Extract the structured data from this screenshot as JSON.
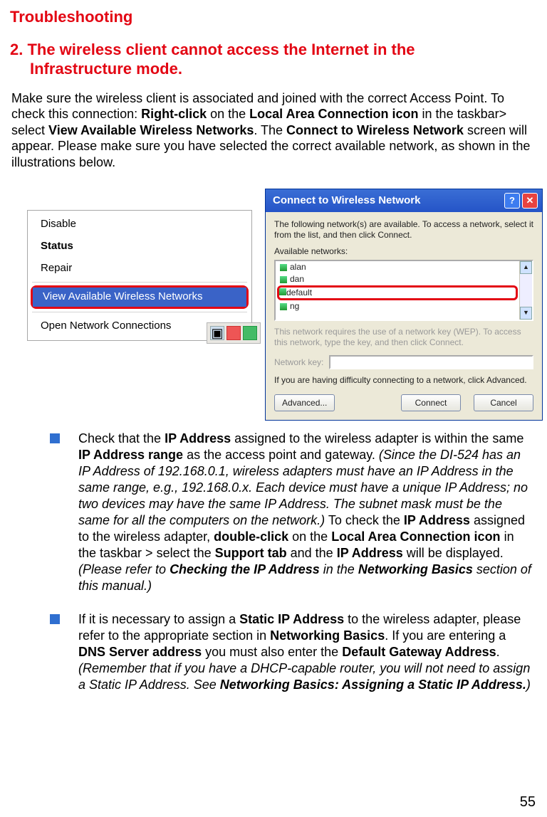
{
  "page_number": "55",
  "h1": "Troubleshooting",
  "h2_line1": "2. The wireless client cannot access the Internet in the",
  "h2_line2": "Infrastructure mode.",
  "intro": {
    "p1a": "Make sure the wireless client is associated and joined with the correct Access Point. To check this connection: ",
    "b1": "Right-click",
    "p1b": " on the ",
    "b2": "Local Area Connection icon",
    "p1c": " in the taskbar> select ",
    "b3": "View Available Wireless Networks",
    "p1d": ". The ",
    "b4": "Connect to Wireless Network",
    "p1e": " screen will appear. Please make sure you have selected the correct available network, as shown in the illustrations below."
  },
  "context_menu": {
    "items": [
      "Disable",
      "Status",
      "Repair"
    ],
    "highlighted": "View Available Wireless Networks",
    "last": "Open Network Connections"
  },
  "dialog": {
    "title": "Connect to Wireless Network",
    "intro": "The following network(s) are available. To access a network, select it from the list, and then click Connect.",
    "available_label": "Available networks:",
    "networks": [
      "alan",
      "dan",
      "default",
      "ng"
    ],
    "selected": "default",
    "wep_note": "This network requires the use of a network key (WEP). To access this network, type the key, and then click Connect.",
    "key_label": "Network key:",
    "help_text": "If you are having difficulty connecting to a network, click Advanced.",
    "btn_advanced": "Advanced...",
    "btn_connect": "Connect",
    "btn_cancel": "Cancel"
  },
  "bullets": {
    "b1": {
      "t1": "Check that the ",
      "s1": "IP Address",
      "t2": " assigned to the wireless adapter is within the same ",
      "s2": "IP Address range",
      "t3": " as the access point and gateway. ",
      "i1": "(Since the DI-524 has an IP Address of 192.168.0.1, wireless adapters must have an IP Address in the same range, e.g., 192.168.0.x. Each device must have a unique IP Address; no two devices may have the same IP Address. The subnet mask must be the same for all the computers on the network.)",
      "t4": " To check the ",
      "s3": "IP Address",
      "t5": " assigned to the wireless adapter, ",
      "s4": "double-click",
      "t6": " on the ",
      "s5": "Local Area Connection icon",
      "t7": " in the taskbar > select the ",
      "s6": "Support tab",
      "t8": " and the ",
      "s7": "IP Address",
      "t9": " will be displayed. ",
      "i2a": "(Please refer to ",
      "i2b": "Checking the IP Address",
      "i2c": " in the ",
      "i2d": "Networking Basics",
      "i2e": " section of this manual.)"
    },
    "b2": {
      "t1": "If it is necessary to assign a ",
      "s1": "Static IP Address",
      "t2": " to the wireless adapter, please refer to the appropriate section in ",
      "s2": "Networking Basics",
      "t3": ". If you are entering a ",
      "s3": "DNS Server address",
      "t4": " you must also enter the ",
      "s4": "Default Gateway Address",
      "t5": ". ",
      "i1a": "(Remember that if you have a DHCP-capable router, you will not need to assign a Static IP Address. See  ",
      "i1b": "Networking Basics: Assigning a Static IP Address.",
      "i1c": ")"
    }
  }
}
